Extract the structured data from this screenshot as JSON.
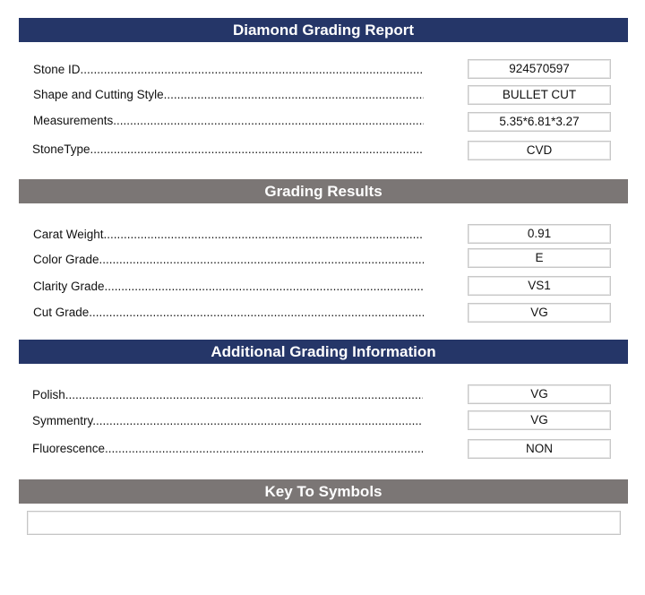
{
  "sections": [
    {
      "title": "Diamond Grading Report",
      "rows": [
        {
          "label": "Stone ID",
          "value": "924570597"
        },
        {
          "label": "Shape and Cutting Style",
          "value": "BULLET CUT"
        },
        {
          "label": "Measurements",
          "value": "5.35*6.81*3.27"
        },
        {
          "label": "StoneType",
          "value": "CVD"
        }
      ]
    },
    {
      "title": "Grading Results",
      "rows": [
        {
          "label": "Carat Weight",
          "value": "0.91"
        },
        {
          "label": "Color Grade",
          "value": "E"
        },
        {
          "label": "Clarity Grade",
          "value": "VS1"
        },
        {
          "label": "Cut Grade",
          "value": "VG"
        }
      ]
    },
    {
      "title": "Additional Grading Information",
      "rows": [
        {
          "label": "Polish",
          "value": "VG"
        },
        {
          "label": "Symmentry",
          "value": "VG"
        },
        {
          "label": "Fluorescence",
          "value": "NON"
        }
      ]
    },
    {
      "title": "Key To Symbols",
      "rows": []
    }
  ],
  "key_to_symbols": "",
  "colors": {
    "primary_header": "#253668",
    "secondary_header": "#7b7675"
  }
}
